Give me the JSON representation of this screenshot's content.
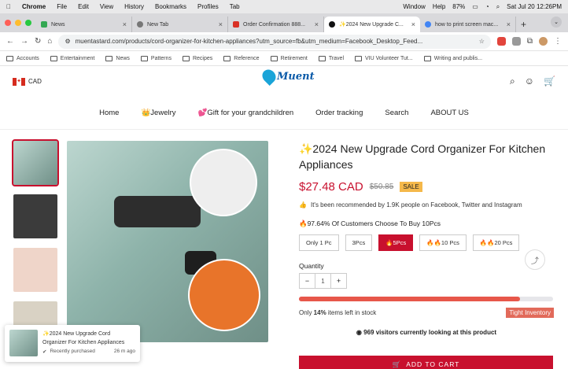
{
  "menubar": {
    "app": "Chrome",
    "items": [
      "File",
      "Edit",
      "View",
      "History",
      "Bookmarks",
      "Profiles",
      "Tab",
      "Window",
      "Help"
    ],
    "battery": "87%",
    "datetime": "Sat Jul 20  12:26PM"
  },
  "tabs": [
    {
      "label": "News",
      "color": "#34a853"
    },
    {
      "label": "New Tab",
      "color": "#777777"
    },
    {
      "label": "Order Confirmation 888...",
      "color": "#d93025"
    },
    {
      "label": "✨2024 New Upgrade C...",
      "color": "#111111"
    },
    {
      "label": "how to print screen mac...",
      "color": "#4285f4"
    }
  ],
  "address": {
    "url": "muentastard.com/products/cord-organizer-for-kitchen-appliances?utm_source=fb&utm_medium=Facebook_Desktop_Feed..."
  },
  "bookmarks": [
    "Accounts",
    "Entertainment",
    "News",
    "Patterns",
    "Recipes",
    "Reference",
    "Retirement",
    "Travel",
    "VIU Volunteer Tut...",
    "Writing and publis..."
  ],
  "header": {
    "currency": "CAD",
    "logo": "Muent"
  },
  "nav": [
    "Home",
    "👑Jewelry",
    "💕Gift for your grandchildren",
    "Order tracking",
    "Search",
    "ABOUT US"
  ],
  "product": {
    "title": "✨2024 New Upgrade Cord Organizer For Kitchen Appliances",
    "price": "$27.48 CAD",
    "old_price": "$50.85",
    "sale": "SALE",
    "recommend": "It's been recommended by 1.9K people on Facebook, Twitter and Instagram",
    "percent": "🔥97.64% Of Customers Choose To Buy 10Pcs",
    "options": [
      "Only 1 Pc",
      "3Pcs",
      "🔥5Pcs",
      "🔥🔥10 Pcs",
      "🔥🔥20 Pcs"
    ],
    "quantity_label": "Quantity",
    "quantity": "1",
    "stock_level": 0.87,
    "stock_pre": "Only ",
    "stock_num": "14%",
    "stock_post": " items left in stock",
    "tight": "Tight Inventory",
    "visitors": "969 visitors currently looking at this product",
    "cart": "ADD TO CART"
  },
  "popup": {
    "title": "✨2024 New Upgrade Cord Organizer For Kitchen Appliances",
    "status": "Recently purchased",
    "time": "26 m ago"
  }
}
